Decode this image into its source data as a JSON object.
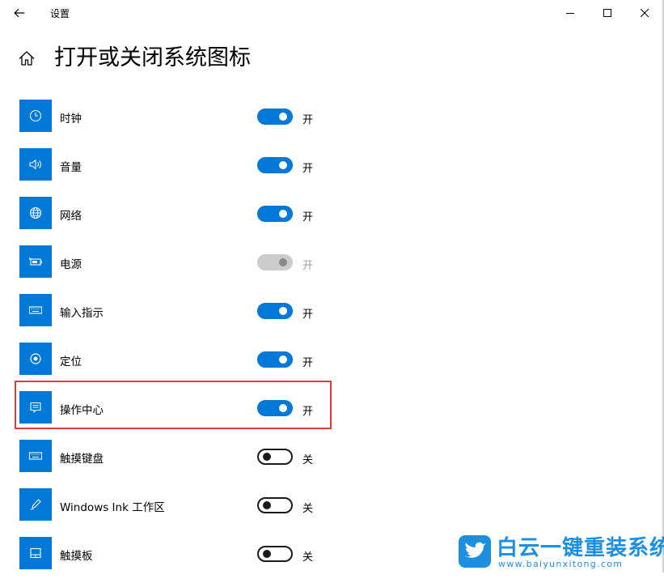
{
  "window": {
    "title": "设置",
    "controls": [
      "minimize",
      "maximize",
      "close"
    ]
  },
  "page": {
    "title": "打开或关闭系统图标"
  },
  "items": [
    {
      "label": "时钟",
      "icon": "clock-icon",
      "state": "开",
      "on": true,
      "disabled": false
    },
    {
      "label": "音量",
      "icon": "volume-icon",
      "state": "开",
      "on": true,
      "disabled": false
    },
    {
      "label": "网络",
      "icon": "globe-icon",
      "state": "开",
      "on": true,
      "disabled": false
    },
    {
      "label": "电源",
      "icon": "battery-icon",
      "state": "开",
      "on": true,
      "disabled": true
    },
    {
      "label": "输入指示",
      "icon": "keyboard-icon",
      "state": "开",
      "on": true,
      "disabled": false
    },
    {
      "label": "定位",
      "icon": "location-icon",
      "state": "开",
      "on": true,
      "disabled": false
    },
    {
      "label": "操作中心",
      "icon": "action-center-icon",
      "state": "开",
      "on": true,
      "disabled": false,
      "highlighted": true
    },
    {
      "label": "触摸键盘",
      "icon": "keyboard-icon",
      "state": "关",
      "on": false,
      "disabled": false
    },
    {
      "label": "Windows Ink 工作区",
      "icon": "pen-icon",
      "state": "关",
      "on": false,
      "disabled": false
    },
    {
      "label": "触摸板",
      "icon": "touchpad-icon",
      "state": "关",
      "on": false,
      "disabled": false
    }
  ],
  "colors": {
    "accent": "#0078d7",
    "highlight": "#e03a3a",
    "watermark": "#1c8fe0"
  },
  "watermark": {
    "title": "白云一键重装系统",
    "url": "www.baiyunxitong.com"
  }
}
